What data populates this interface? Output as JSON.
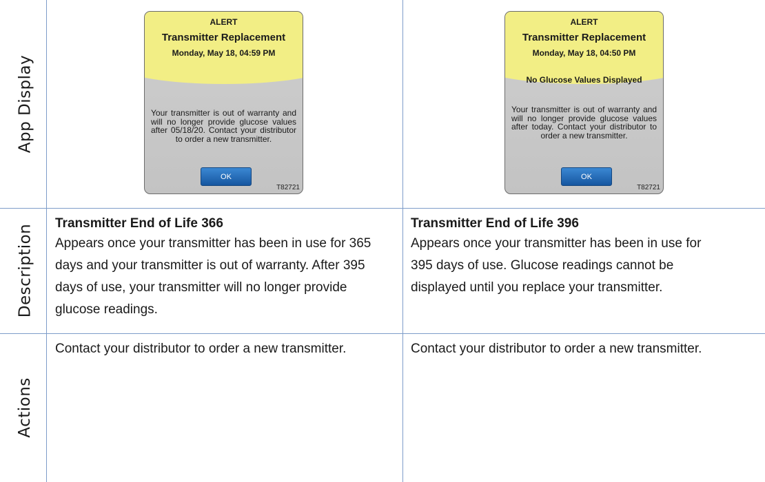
{
  "rows": {
    "app_display": "App Display",
    "description": "Description",
    "actions": "Actions"
  },
  "cards": [
    {
      "alert": "ALERT",
      "title": "Transmitter Replacement",
      "date": "Monday, May 18, 04:59 PM",
      "no_glucose": "",
      "message": "Your transmitter is out of warranty and will no longer provide glucose values after 05/18/20. Contact your distributor to order a new transmitter.",
      "ok": "OK",
      "code": "T82721"
    },
    {
      "alert": "ALERT",
      "title": "Transmitter Replacement",
      "date": "Monday, May 18, 04:50 PM",
      "no_glucose": "No Glucose Values Displayed",
      "message": "Your transmitter is out of warranty and will no longer provide glucose values after today. Contact your distributor to order a new transmitter.",
      "ok": "OK",
      "code": "T82721"
    }
  ],
  "descriptions": [
    {
      "heading": "Transmitter End of Life 366",
      "body": "Appears once your transmitter has been in use for 365 days and your transmitter is out of warranty. After 395 days of use, your transmitter will no longer provide glucose readings."
    },
    {
      "heading": "Transmitter End of Life 396",
      "body": "Appears once your transmitter has been in use for 395 days of use. Glucose readings cannot be displayed until you replace your transmitter."
    }
  ],
  "actions": [
    "Contact your distributor to order a new transmitter.",
    "Contact your distributor to order a new transmitter."
  ]
}
